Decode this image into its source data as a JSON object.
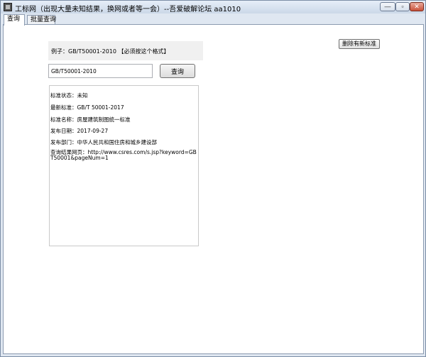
{
  "window": {
    "title": "工标网（出现大量未知结果，换网或者等一会）--吾爱破解论坛 aa1010",
    "controls": {
      "minimize": "—",
      "maximize": "▫",
      "close": "✕"
    }
  },
  "tabs": [
    {
      "label": "查询",
      "active": true
    },
    {
      "label": "批量查询",
      "active": false
    }
  ],
  "main": {
    "delete_button_label": "删除有新标准",
    "example_text": "例子：GB/T50001-2010    【必须按这个格式】",
    "query_input_value": "GB/T50001-2010",
    "query_button_label": "查询",
    "result": {
      "status": "标准状态：未知",
      "latest": "最新标准：GB/T 50001-2017",
      "name": "标准名称：房屋建筑制图统一标准",
      "date": "发布日期：2017-09-27",
      "department": "发布部门：中华人民共和国住房和城乡建设部",
      "url": "查询结果网页：http://www.csres.com/s.jsp?keyword=GBT50001&pageNum=1"
    }
  },
  "colors": {
    "close_button": "#c8513a",
    "window_frame": "#dfe7f1",
    "panel_bg": "#ffffff"
  },
  "icons": {
    "app": "app-icon"
  }
}
